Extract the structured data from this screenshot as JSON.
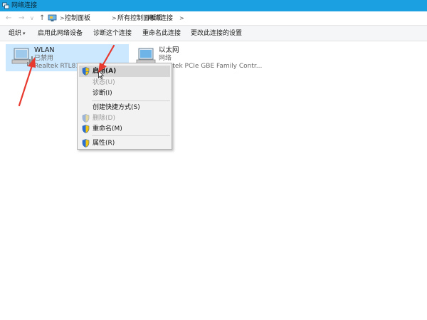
{
  "window": {
    "title": "网络连接",
    "accent": "#1ba1e2"
  },
  "address": {
    "crumbs": [
      "控制面板",
      "所有控制面板项",
      "网络连接"
    ],
    "separator": ">"
  },
  "nav": {
    "back": "←",
    "forward": "→",
    "history": "∨",
    "up": "↑"
  },
  "commandbar": {
    "organize": "组织",
    "organize_caret": "▾",
    "enable_device": "启用此网络设备",
    "diagnose": "诊断这个连接",
    "rename": "重命名此连接",
    "change_settings": "更改此连接的设置"
  },
  "connections": [
    {
      "name": "WLAN",
      "status": "已禁用",
      "device": "Realtek RTL8192EU Wireless..."
    },
    {
      "name": "以太网",
      "status": "网络",
      "device": "Realtek PCIe GBE Family Contr..."
    }
  ],
  "context_menu": {
    "items": [
      {
        "label": "启用(A)",
        "shield": true,
        "disabled": false,
        "highlight": true
      },
      {
        "label": "状态(U)",
        "shield": false,
        "disabled": true,
        "highlight": false
      },
      {
        "label": "诊断(I)",
        "shield": false,
        "disabled": false,
        "highlight": false
      },
      {
        "label": "创建快捷方式(S)",
        "shield": false,
        "disabled": false,
        "highlight": false
      },
      {
        "label": "删除(D)",
        "shield": true,
        "disabled": true,
        "highlight": false
      },
      {
        "label": "重命名(M)",
        "shield": true,
        "disabled": false,
        "highlight": false
      },
      {
        "label": "属性(R)",
        "shield": true,
        "disabled": false,
        "highlight": false
      }
    ]
  },
  "annotation_color": "#e8392f"
}
